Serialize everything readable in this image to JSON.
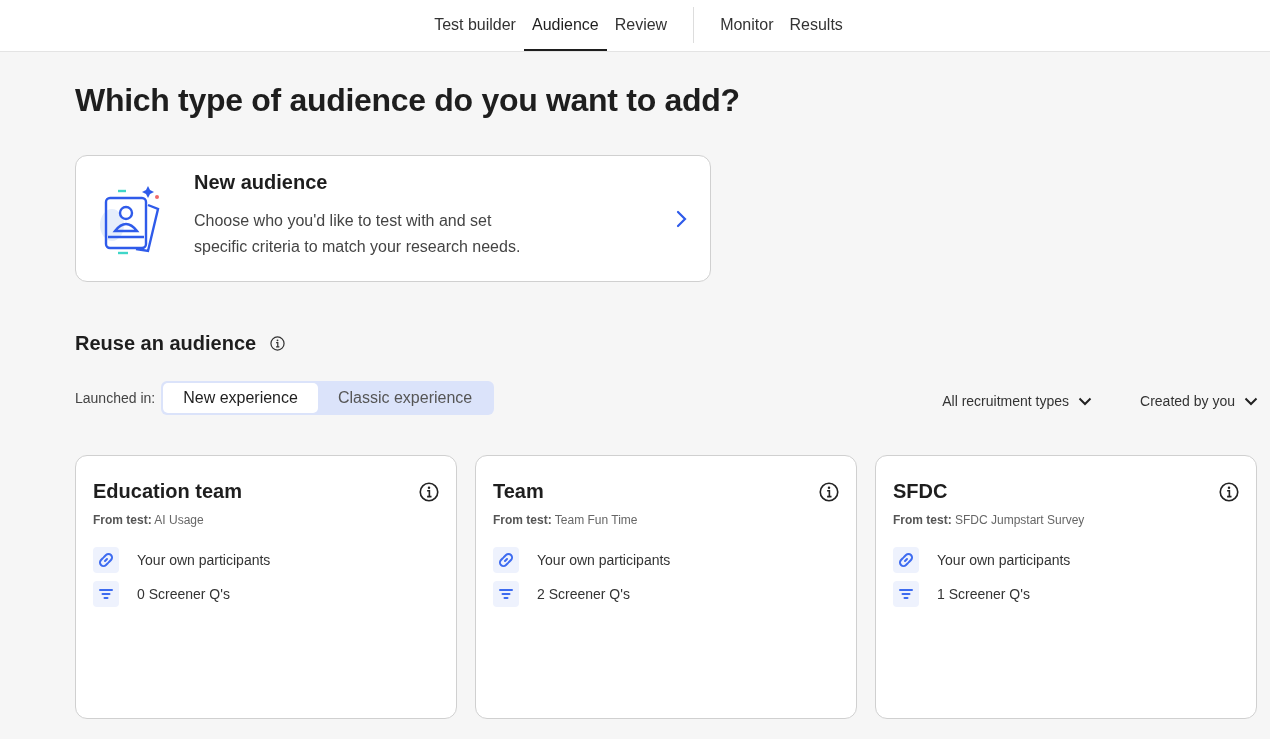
{
  "nav": {
    "groups": [
      {
        "tabs": [
          {
            "label": "Test builder",
            "selected": false
          },
          {
            "label": "Audience",
            "selected": true
          },
          {
            "label": "Review",
            "selected": false
          }
        ]
      },
      {
        "tabs": [
          {
            "label": "Monitor",
            "selected": false
          },
          {
            "label": "Results",
            "selected": false
          }
        ]
      }
    ]
  },
  "heading": "Which type of audience do you want to add?",
  "new_audience": {
    "title": "New audience",
    "description": "Choose who you'd like to test with and set specific criteria to match your research needs."
  },
  "reuse": {
    "title": "Reuse an audience",
    "launched_label": "Launched in:",
    "toggle": [
      {
        "label": "New experience",
        "selected": true
      },
      {
        "label": "Classic experience",
        "selected": false
      }
    ],
    "filters": [
      "All recruitment types",
      "Created by you"
    ],
    "cards": [
      {
        "title": "Education team",
        "source": "**From test:** AI Usage",
        "features": [
          {
            "kind": "link",
            "text": "Your own participants"
          },
          {
            "kind": "filter",
            "text": "0 Screener Q's"
          }
        ]
      },
      {
        "title": "Team",
        "source": "**From test:** Team Fun Time",
        "features": [
          {
            "kind": "link",
            "text": "Your own participants"
          },
          {
            "kind": "filter",
            "text": "2 Screener Q's"
          }
        ]
      },
      {
        "title": "SFDC",
        "source": "**From test:** SFDC Jumpstart Survey",
        "features": [
          {
            "kind": "link",
            "text": "Your own participants"
          },
          {
            "kind": "filter",
            "text": "1 Screener Q's"
          }
        ]
      }
    ]
  }
}
